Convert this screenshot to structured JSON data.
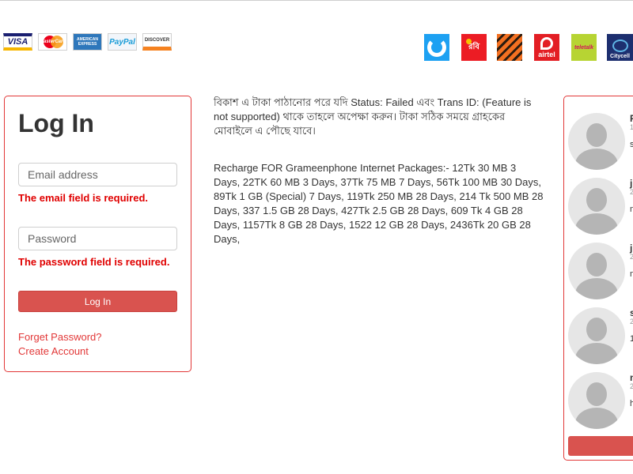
{
  "payments": {
    "visa": "VISA",
    "mastercard": "MasterCard",
    "amex": "AMERICAN EXPRESS",
    "paypal": "PayPal",
    "discover": "DISCOVER"
  },
  "operators": {
    "robi": "রবি",
    "airtel": "airtel",
    "teletalk": "teletalk",
    "citycell": "Citycell"
  },
  "login": {
    "title": "Log In",
    "email_placeholder": "Email address",
    "email_error": "The email field is required.",
    "password_placeholder": "Password",
    "password_error": "The password field is required.",
    "button": "Log In",
    "forgot": "Forget Password?",
    "create": "Create Account"
  },
  "info": {
    "notice": "বিকাশ এ টাকা পাঠানোর পরে যদি Status: Failed এবং Trans ID: (Feature is not supported) থাকে তাহলে অপেক্ষা করুন। টাকা সঠিক সময়ে গ্রাহকের মোবাইলে এ পৌছে যাবে।",
    "packages": "Recharge FOR Grameenphone Internet Packages:- 12Tk 30 MB 3 Days, 22TK 60 MB 3 Days, 37Tk 75 MB 7 Days, 56Tk 100 MB 30 Days, 89Tk 1 GB (Special) 7 Days, 119Tk 250 MB 28 Days, 214 Tk 500 MB 28 Days, 337 1.5 GB 28 Days, 427Tk 2.5 GB 28 Days, 609 Tk 4 GB 28 Days, 1157Tk 8 GB 28 Days, 1522 12 GB 28 Days, 2436Tk 20 GB 28 Days,"
  },
  "users": [
    {
      "name": "F",
      "meta": "1",
      "text": "s"
    },
    {
      "name": "j",
      "meta": "2",
      "text": "m"
    },
    {
      "name": "j",
      "meta": "2",
      "text": "m"
    },
    {
      "name": "s",
      "meta": "2",
      "text": "1"
    },
    {
      "name": "n",
      "meta": "2",
      "text": "h"
    }
  ]
}
